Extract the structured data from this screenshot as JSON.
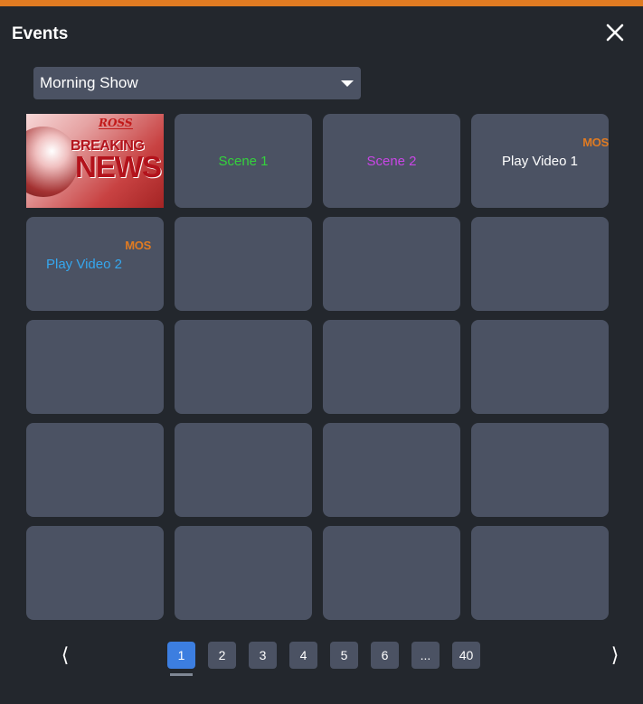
{
  "header": {
    "title": "Events"
  },
  "dropdown": {
    "value": "Morning Show"
  },
  "tiles": [
    {
      "kind": "thumbnail",
      "thumb_brand": "ROSS",
      "thumb_line1": "BREAKING",
      "thumb_line2": "NEWS"
    },
    {
      "kind": "scene",
      "label": "Scene 1",
      "color": "#34d23c"
    },
    {
      "kind": "scene",
      "label": "Scene 2",
      "color": "#c946e6"
    },
    {
      "kind": "video",
      "label": "Play Video 1",
      "badge": "MOS",
      "color": "#ffffff"
    },
    {
      "kind": "video",
      "label": "Play Video 2",
      "badge": "MOS",
      "color": "#35a7ef"
    }
  ],
  "empty_tile_count": 15,
  "pagination": {
    "pages": [
      "1",
      "2",
      "3",
      "4",
      "5",
      "6",
      "...",
      "40"
    ],
    "current": "1",
    "prev_icon": "chevron-left-icon",
    "next_icon": "chevron-right-icon"
  },
  "colors": {
    "accent": "#e07b22",
    "active_page": "#3c7ee0",
    "tile": "#4b5263",
    "background": "#23272d"
  }
}
